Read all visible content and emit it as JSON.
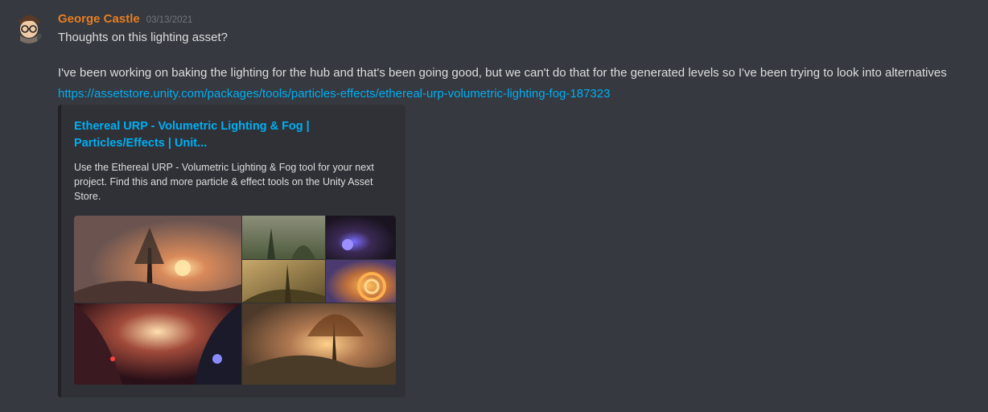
{
  "message": {
    "author": "George Castle",
    "timestamp": "03/13/2021",
    "line1": "Thoughts on this lighting asset?",
    "line2": "I've been working on baking the lighting for the hub and that's been going good, but we can't do that for the generated levels so I've been trying to look into alternatives",
    "link": "https://assetstore.unity.com/packages/tools/particles-effects/ethereal-urp-volumetric-lighting-fog-187323"
  },
  "embed": {
    "title": "Ethereal URP - Volumetric Lighting & Fog | Particles/Effects | Unit...",
    "description": "Use the Ethereal URP - Volumetric Lighting & Fog tool for your next project. Find this and more particle & effect tools on the Unity Asset Store."
  },
  "colors": {
    "background": "#36393f",
    "username": "#e67e22",
    "link": "#00aff4",
    "embed_bg": "#2f3136"
  }
}
